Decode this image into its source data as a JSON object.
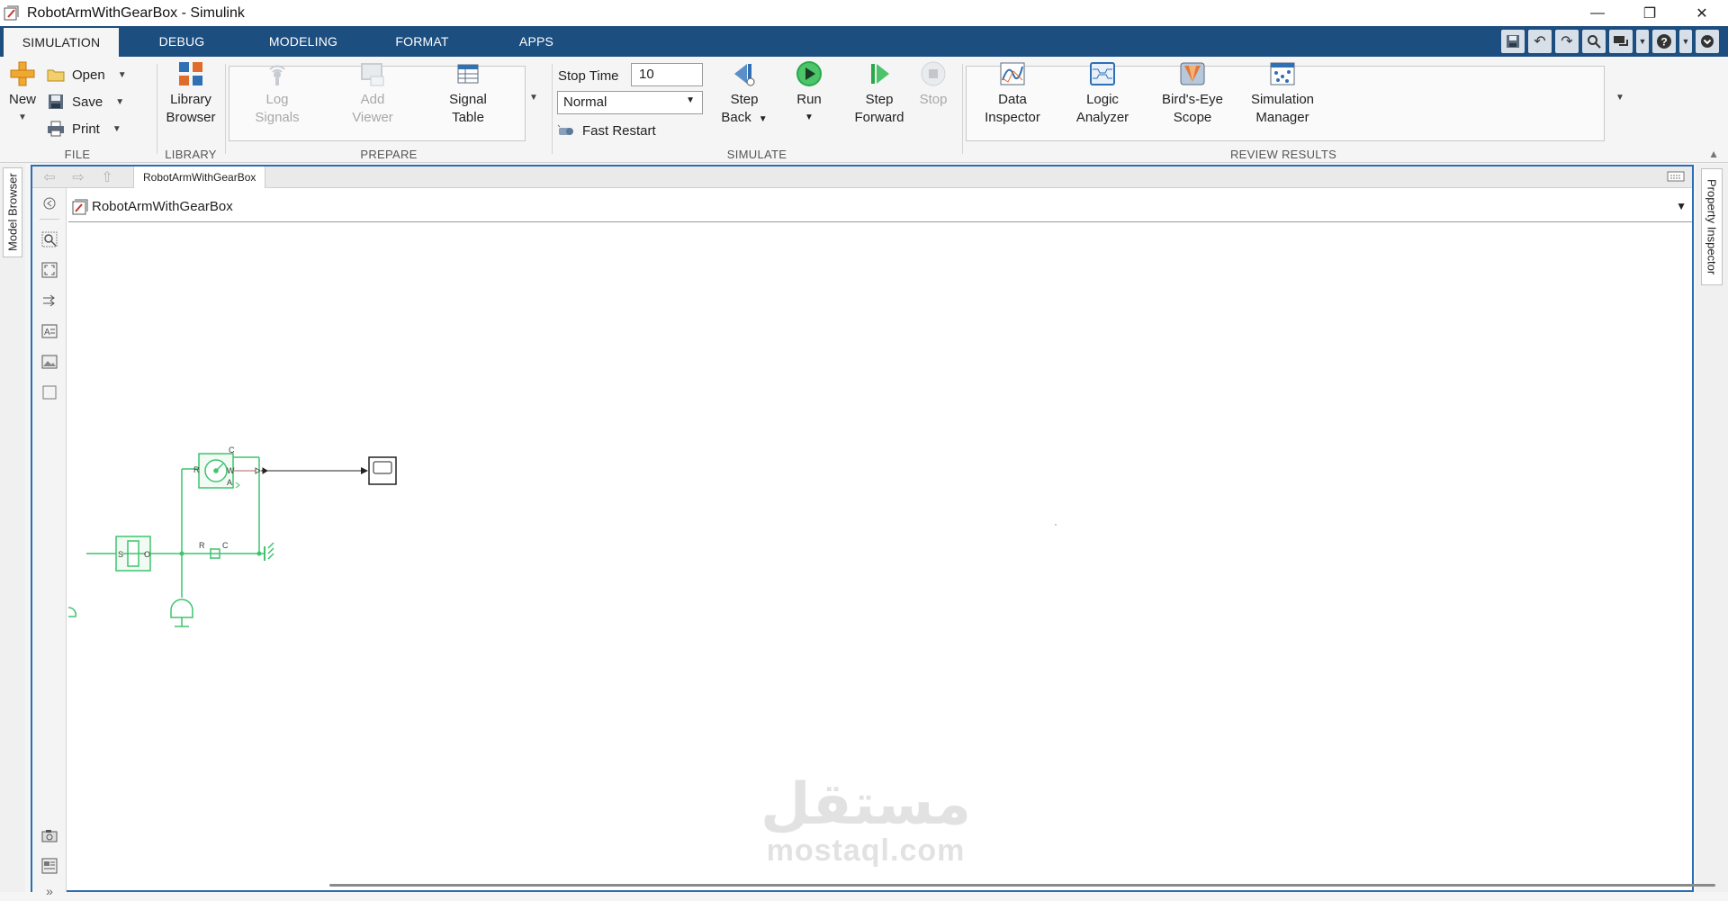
{
  "window": {
    "title": "RobotArmWithGearBox - Simulink",
    "minimize": "—",
    "restore": "❐",
    "close": "✕"
  },
  "tabs": [
    {
      "label": "SIMULATION"
    },
    {
      "label": "DEBUG"
    },
    {
      "label": "MODELING"
    },
    {
      "label": "FORMAT"
    },
    {
      "label": "APPS"
    }
  ],
  "file": {
    "group_label": "FILE",
    "new_label": "New",
    "open_label": "Open",
    "save_label": "Save",
    "print_label": "Print"
  },
  "library": {
    "group_label": "LIBRARY",
    "browser_line1": "Library",
    "browser_line2": "Browser"
  },
  "prepare": {
    "group_label": "PREPARE",
    "log_line1": "Log",
    "log_line2": "Signals",
    "viewer_line1": "Add",
    "viewer_line2": "Viewer",
    "table_line1": "Signal",
    "table_line2": "Table"
  },
  "simulate": {
    "group_label": "SIMULATE",
    "stop_time_label": "Stop Time",
    "stop_time_value": "10",
    "mode_value": "Normal",
    "fast_restart_label": "Fast Restart",
    "step_back_line1": "Step",
    "step_back_line2": "Back",
    "run_label": "Run",
    "step_fwd_line1": "Step",
    "step_fwd_line2": "Forward",
    "stop_label": "Stop"
  },
  "review": {
    "group_label": "REVIEW RESULTS",
    "data_line1": "Data",
    "data_line2": "Inspector",
    "logic_line1": "Logic",
    "logic_line2": "Analyzer",
    "birds_line1": "Bird's-Eye",
    "birds_line2": "Scope",
    "simmgr_line1": "Simulation",
    "simmgr_line2": "Manager"
  },
  "panels": {
    "model_browser": "Model Browser",
    "property_inspector": "Property Inspector"
  },
  "editor": {
    "breadcrumb_tab": "RobotArmWithGearBox",
    "address": "RobotArmWithGearBox"
  },
  "diagram": {
    "sensor_ports": [
      "R",
      "C",
      "W",
      "A"
    ],
    "source_ports": [
      "S",
      "O"
    ],
    "spring_ports": [
      "R",
      "C"
    ]
  },
  "watermark": {
    "arabic": "مستقل",
    "latin": "mostaql.com"
  },
  "colors": {
    "tab_bar": "#1c4e80",
    "editor_border": "#2a6db5",
    "block_green": "#3ec46d",
    "run_green": "#2aa84a"
  }
}
